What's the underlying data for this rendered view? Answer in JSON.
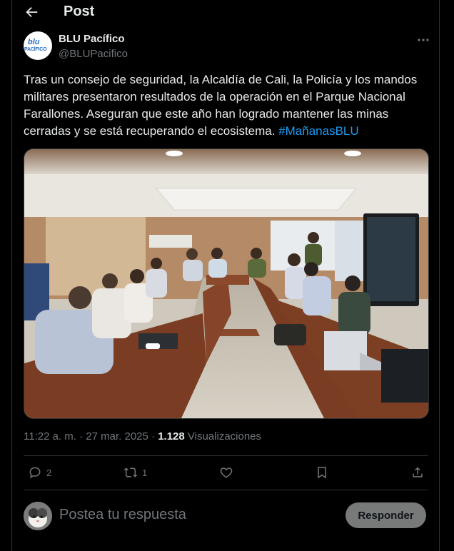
{
  "header": {
    "title": "Post"
  },
  "author": {
    "name": "BLU Pacífico",
    "handle": "@BLUPacifico",
    "logo_text_top": "blu",
    "logo_text_bottom": "PACÍFICO"
  },
  "post": {
    "text": "Tras un consejo de seguridad, la Alcaldía de Cali, la Policía y los mandos militares presentaron resultados de la operación en el Parque Nacional Farallones. Aseguran que este año han logrado mantener las minas cerradas y se está recuperando el ecosistema. ",
    "hashtag": "#MañanasBLU"
  },
  "meta": {
    "time": "11:22 a. m.",
    "sep": " · ",
    "date": "27 mar. 2025",
    "sep2": " · ",
    "views_count": "1.128",
    "views_label": " Visualizaciones"
  },
  "actions": {
    "replies": "2",
    "reposts": "1"
  },
  "reply": {
    "placeholder": "Postea tu respuesta",
    "button": "Responder"
  },
  "colors": {
    "accent": "#1d9bf0",
    "muted": "#71767b",
    "border": "#2f3336"
  },
  "icons": [
    "back-arrow-icon",
    "more-icon",
    "reply-icon",
    "repost-icon",
    "like-icon",
    "bookmark-icon",
    "share-icon"
  ]
}
